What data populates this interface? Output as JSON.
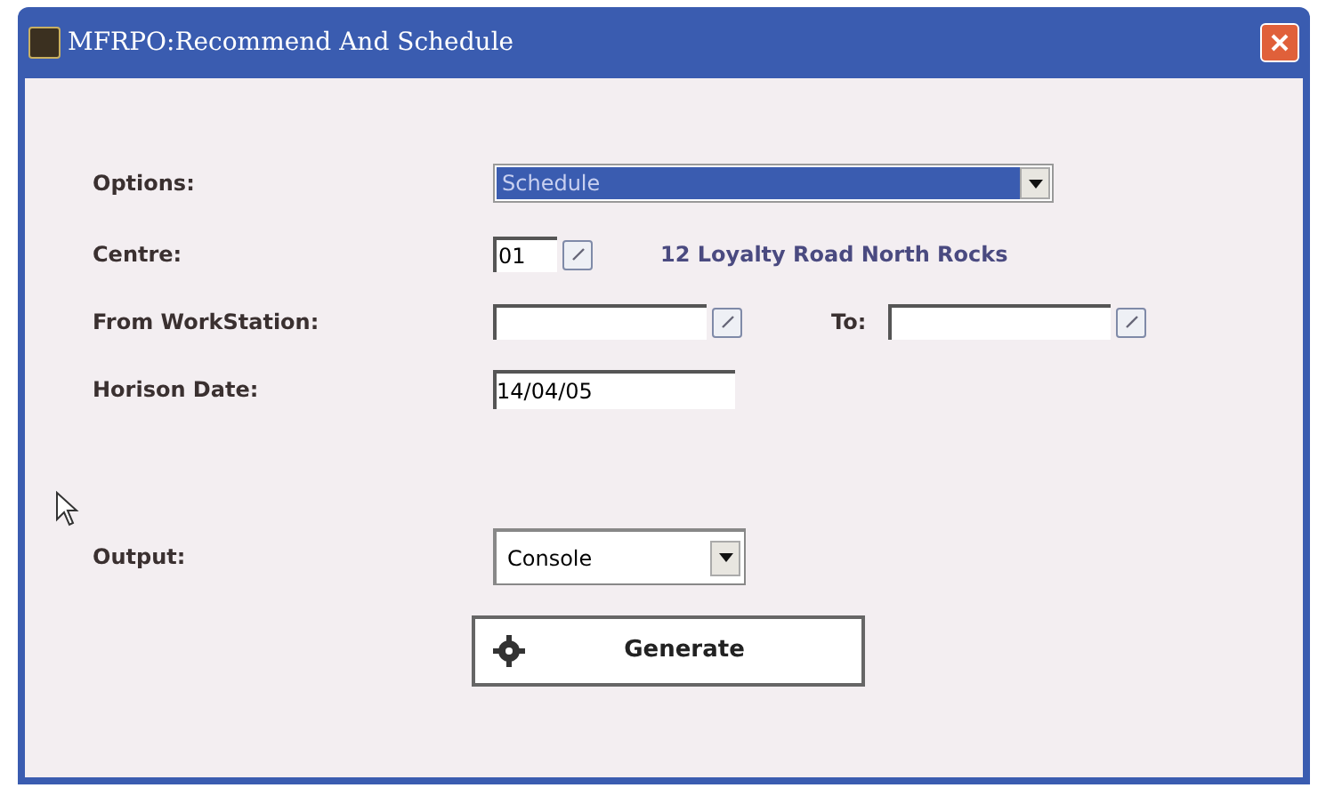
{
  "window": {
    "title": "MFRPO:Recommend And Schedule"
  },
  "options": {
    "label": "Options:",
    "value": "Schedule",
    "selected": true
  },
  "centre": {
    "label": "Centre:",
    "value": "01",
    "description": "12 Loyalty Road North Rocks"
  },
  "from_workstation": {
    "label": "From WorkStation:"
  },
  "to": {
    "label": "To:"
  },
  "horison_date": {
    "label": "Horison Date:",
    "value": "14/04/05"
  },
  "output": {
    "label": "Output:",
    "value": "Console"
  },
  "generate_button": {
    "label": "Generate"
  }
}
